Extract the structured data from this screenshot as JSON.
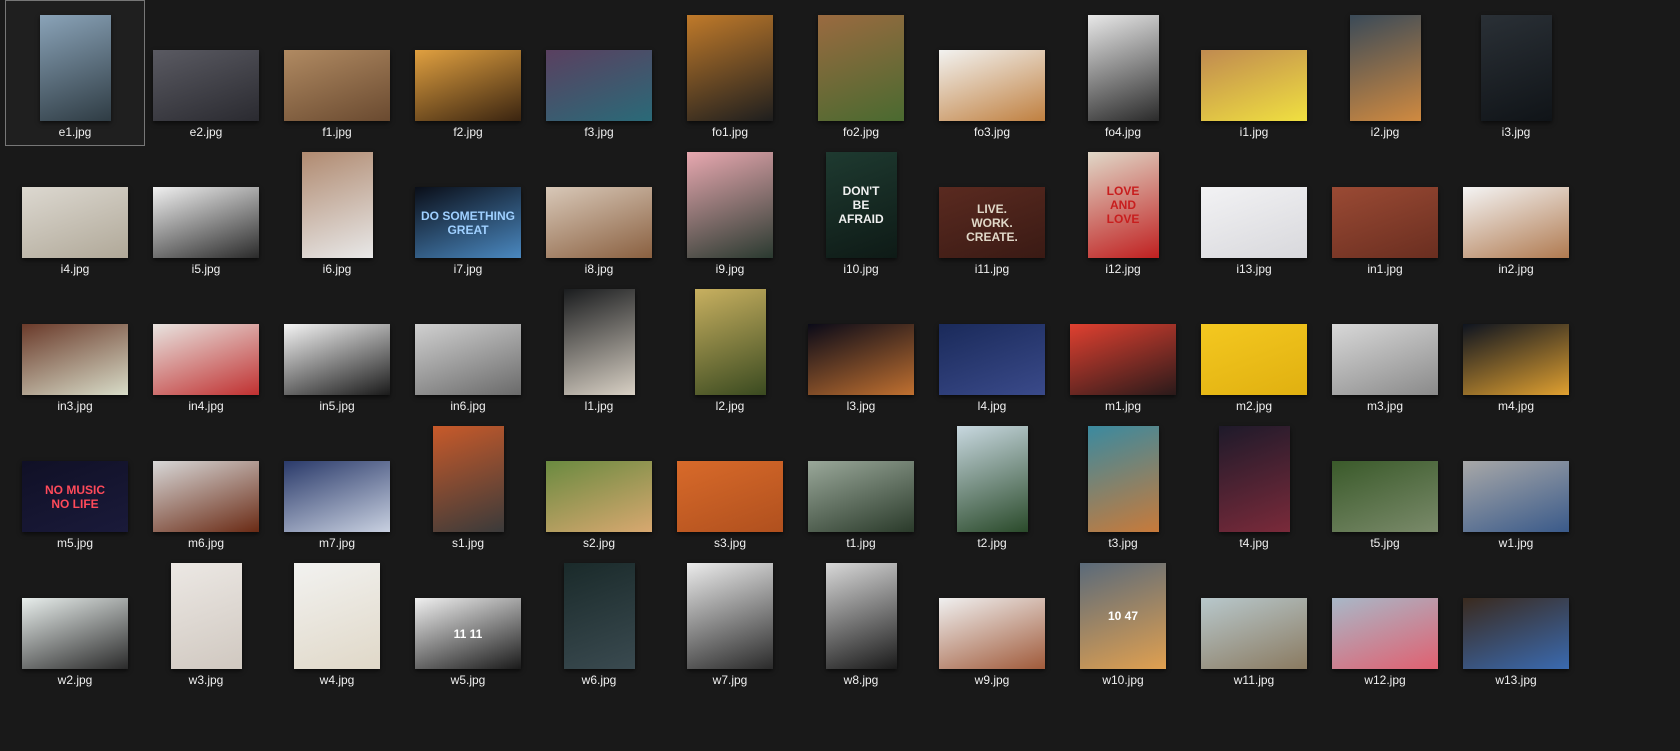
{
  "view": {
    "selected_file": "e1.jpg"
  },
  "files": [
    {
      "name": "e1.jpg",
      "shape": "portrait",
      "colors": [
        "#8aa3b8",
        "#2f3c44"
      ]
    },
    {
      "name": "e2.jpg",
      "shape": "landscape",
      "colors": [
        "#5a5a62",
        "#2a2a30"
      ]
    },
    {
      "name": "f1.jpg",
      "shape": "landscape",
      "colors": [
        "#b08a62",
        "#6a4a30"
      ]
    },
    {
      "name": "f2.jpg",
      "shape": "landscape",
      "colors": [
        "#e0a040",
        "#3a2410"
      ]
    },
    {
      "name": "f3.jpg",
      "shape": "landscape",
      "colors": [
        "#5a4060",
        "#2a6a78"
      ]
    },
    {
      "name": "fo1.jpg",
      "shape": "square",
      "colors": [
        "#c07a2a",
        "#1e1e1e"
      ]
    },
    {
      "name": "fo2.jpg",
      "shape": "square",
      "colors": [
        "#9a6a40",
        "#4a6a30"
      ]
    },
    {
      "name": "fo3.jpg",
      "shape": "landscape",
      "colors": [
        "#f2f2f0",
        "#c08040"
      ]
    },
    {
      "name": "fo4.jpg",
      "shape": "portrait",
      "colors": [
        "#e8e8e8",
        "#2a2a2a"
      ]
    },
    {
      "name": "i1.jpg",
      "shape": "landscape",
      "colors": [
        "#c08a50",
        "#f0e040"
      ]
    },
    {
      "name": "i2.jpg",
      "shape": "portrait",
      "colors": [
        "#3a4a58",
        "#d08a40"
      ]
    },
    {
      "name": "i3.jpg",
      "shape": "portrait",
      "colors": [
        "#2a3036",
        "#101418"
      ]
    },
    {
      "name": "i4.jpg",
      "shape": "landscape",
      "colors": [
        "#dcd8d0",
        "#b0a898"
      ]
    },
    {
      "name": "i5.jpg",
      "shape": "landscape",
      "colors": [
        "#f0f0f0",
        "#2a2a2a"
      ]
    },
    {
      "name": "i6.jpg",
      "shape": "portrait",
      "colors": [
        "#b08a70",
        "#e8e8e8"
      ]
    },
    {
      "name": "i7.jpg",
      "shape": "landscape",
      "colors": [
        "#0a0e18",
        "#4a88c0"
      ],
      "caption": "DO SOMETHING GREAT",
      "caption_color": "#9fd0ff"
    },
    {
      "name": "i8.jpg",
      "shape": "landscape",
      "colors": [
        "#d8c8b8",
        "#8a6040"
      ]
    },
    {
      "name": "i9.jpg",
      "shape": "square",
      "colors": [
        "#e8a8b0",
        "#2a3a30"
      ]
    },
    {
      "name": "i10.jpg",
      "shape": "portrait",
      "colors": [
        "#1e3a30",
        "#0e1a16"
      ],
      "caption": "DON'T\nBE\nAFRAID",
      "caption_color": "#f0f0f0"
    },
    {
      "name": "i11.jpg",
      "shape": "landscape",
      "colors": [
        "#5a2a20",
        "#3a1a14"
      ],
      "caption": "LIVE.\nWORK.\nCREATE.",
      "caption_color": "#e0d8c8"
    },
    {
      "name": "i12.jpg",
      "shape": "portrait",
      "colors": [
        "#e0d8c8",
        "#c02020"
      ],
      "caption": "LOVE\nAND\nLOVE",
      "caption_color": "#c81e1e"
    },
    {
      "name": "i13.jpg",
      "shape": "landscape",
      "colors": [
        "#f2f2f4",
        "#d8d8dc"
      ]
    },
    {
      "name": "in1.jpg",
      "shape": "landscape",
      "colors": [
        "#9a4a34",
        "#6a2e20"
      ]
    },
    {
      "name": "in2.jpg",
      "shape": "landscape",
      "colors": [
        "#f4f4f4",
        "#b07a50"
      ]
    },
    {
      "name": "in3.jpg",
      "shape": "landscape",
      "colors": [
        "#6a3a2a",
        "#d8dcc8"
      ]
    },
    {
      "name": "in4.jpg",
      "shape": "landscape",
      "colors": [
        "#e8e4e0",
        "#c03030"
      ]
    },
    {
      "name": "in5.jpg",
      "shape": "landscape",
      "colors": [
        "#f4f4f4",
        "#1a1a1a"
      ]
    },
    {
      "name": "in6.jpg",
      "shape": "landscape",
      "colors": [
        "#d0d0d0",
        "#6a6a6a"
      ]
    },
    {
      "name": "l1.jpg",
      "shape": "portrait",
      "colors": [
        "#1a1c1e",
        "#d8d0c4"
      ]
    },
    {
      "name": "l2.jpg",
      "shape": "portrait",
      "colors": [
        "#c8b060",
        "#3a4a20"
      ]
    },
    {
      "name": "l3.jpg",
      "shape": "landscape",
      "colors": [
        "#0a0a18",
        "#c07030"
      ]
    },
    {
      "name": "l4.jpg",
      "shape": "landscape",
      "colors": [
        "#1a2a5a",
        "#3a4a8a"
      ]
    },
    {
      "name": "m1.jpg",
      "shape": "landscape",
      "colors": [
        "#e04030",
        "#2a1a1a"
      ]
    },
    {
      "name": "m2.jpg",
      "shape": "landscape",
      "colors": [
        "#f4c820",
        "#e0b010"
      ]
    },
    {
      "name": "m3.jpg",
      "shape": "landscape",
      "colors": [
        "#d8d8d8",
        "#8a8a8a"
      ]
    },
    {
      "name": "m4.jpg",
      "shape": "landscape",
      "colors": [
        "#0e1420",
        "#e0a030"
      ]
    },
    {
      "name": "m5.jpg",
      "shape": "landscape",
      "colors": [
        "#101026",
        "#1a1a3a"
      ],
      "caption": "NO MUSIC\nNO LIFE",
      "caption_color": "#ff4a5a"
    },
    {
      "name": "m6.jpg",
      "shape": "landscape",
      "colors": [
        "#d8d8d8",
        "#6a2a14"
      ]
    },
    {
      "name": "m7.jpg",
      "shape": "landscape",
      "colors": [
        "#2a3a6a",
        "#c8d0e0"
      ]
    },
    {
      "name": "s1.jpg",
      "shape": "portrait",
      "colors": [
        "#c85a2a",
        "#3a3a3a"
      ]
    },
    {
      "name": "s2.jpg",
      "shape": "landscape",
      "colors": [
        "#6a8a40",
        "#d8a870"
      ]
    },
    {
      "name": "s3.jpg",
      "shape": "landscape",
      "colors": [
        "#d86a2a",
        "#b0501e"
      ]
    },
    {
      "name": "t1.jpg",
      "shape": "landscape",
      "colors": [
        "#9aa89a",
        "#2a3a2a"
      ]
    },
    {
      "name": "t2.jpg",
      "shape": "portrait",
      "colors": [
        "#c8d8e0",
        "#2a4a2a"
      ]
    },
    {
      "name": "t3.jpg",
      "shape": "portrait",
      "colors": [
        "#3a8aa0",
        "#c87a3a"
      ]
    },
    {
      "name": "t4.jpg",
      "shape": "portrait",
      "colors": [
        "#1e1a2a",
        "#7a2a3a"
      ]
    },
    {
      "name": "t5.jpg",
      "shape": "landscape",
      "colors": [
        "#3a5a2a",
        "#7a8a6a"
      ]
    },
    {
      "name": "w1.jpg",
      "shape": "landscape",
      "colors": [
        "#a8a8a8",
        "#3a5a8a"
      ]
    },
    {
      "name": "w2.jpg",
      "shape": "landscape",
      "colors": [
        "#e8eeec",
        "#2a2a2a"
      ]
    },
    {
      "name": "w3.jpg",
      "shape": "portrait",
      "colors": [
        "#ece8e4",
        "#d0c8c0"
      ]
    },
    {
      "name": "w4.jpg",
      "shape": "square",
      "colors": [
        "#f2f2f0",
        "#e0d8c8"
      ]
    },
    {
      "name": "w5.jpg",
      "shape": "landscape",
      "colors": [
        "#f0f0f0",
        "#1a1a1a"
      ],
      "caption": "11 11",
      "caption_color": "#ffffff"
    },
    {
      "name": "w6.jpg",
      "shape": "portrait",
      "colors": [
        "#1a2a2a",
        "#3a4a50"
      ]
    },
    {
      "name": "w7.jpg",
      "shape": "square",
      "colors": [
        "#ececec",
        "#2a2a2a"
      ]
    },
    {
      "name": "w8.jpg",
      "shape": "portrait",
      "colors": [
        "#d8d8d8",
        "#1a1a1a"
      ]
    },
    {
      "name": "w9.jpg",
      "shape": "landscape",
      "colors": [
        "#f0f0f0",
        "#a05a3a"
      ]
    },
    {
      "name": "w10.jpg",
      "shape": "square",
      "colors": [
        "#5a6a7a",
        "#e0a050"
      ],
      "caption": "10 47",
      "caption_color": "#ffffff"
    },
    {
      "name": "w11.jpg",
      "shape": "landscape",
      "colors": [
        "#b8c8cc",
        "#8a7a60"
      ]
    },
    {
      "name": "w12.jpg",
      "shape": "landscape",
      "colors": [
        "#a8b8c8",
        "#e06070"
      ]
    },
    {
      "name": "w13.jpg",
      "shape": "landscape",
      "colors": [
        "#3a2a1e",
        "#3a6ab0"
      ]
    }
  ]
}
